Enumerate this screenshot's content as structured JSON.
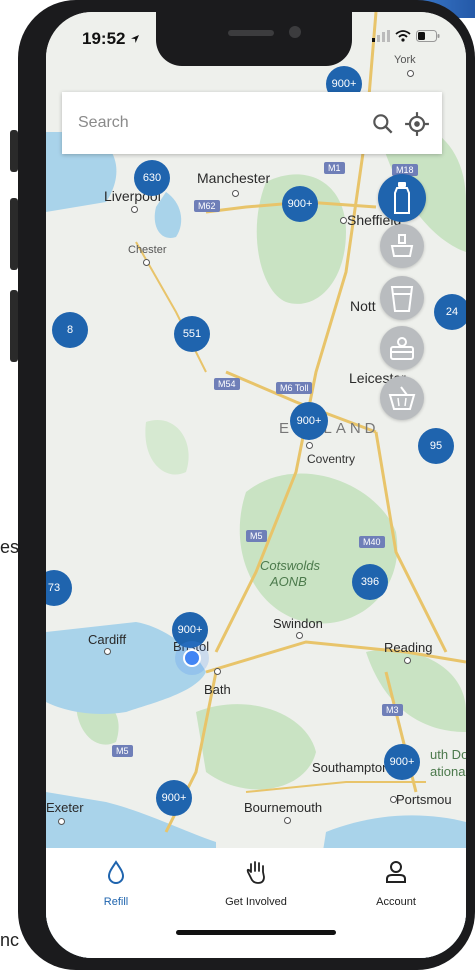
{
  "status_bar": {
    "time": "19:52"
  },
  "search": {
    "placeholder": "Search"
  },
  "map": {
    "places": [
      {
        "name": "York"
      },
      {
        "name": "Manchester"
      },
      {
        "name": "Liverpool"
      },
      {
        "name": "Sheffield"
      },
      {
        "name": "Chester"
      },
      {
        "name": "Nott"
      },
      {
        "name": "Leicester"
      },
      {
        "name": "ENGLAND"
      },
      {
        "name": "Coventry"
      },
      {
        "name": "Cotswolds"
      },
      {
        "name": "AONB"
      },
      {
        "name": "Swindon"
      },
      {
        "name": "Cardiff"
      },
      {
        "name": "Bristol"
      },
      {
        "name": "Reading"
      },
      {
        "name": "Bath"
      },
      {
        "name": "Southampton"
      },
      {
        "name": "uth Do"
      },
      {
        "name": "ational"
      },
      {
        "name": "Exeter"
      },
      {
        "name": "Bournemouth"
      },
      {
        "name": "Portsmou"
      }
    ],
    "roads": [
      "M1",
      "M62",
      "M18",
      "M54",
      "M6 Toll",
      "M5",
      "M40",
      "M3",
      "M5"
    ],
    "clusters": [
      "900+",
      "630",
      "900+",
      "24",
      "8",
      "551",
      "900+",
      "95",
      "396",
      "73",
      "900+",
      "900+",
      "900+"
    ]
  },
  "categories": [
    {
      "name": "bottle-icon",
      "active": true
    },
    {
      "name": "tap-icon",
      "active": false
    },
    {
      "name": "cup-icon",
      "active": false
    },
    {
      "name": "lunchbox-icon",
      "active": false
    },
    {
      "name": "basket-icon",
      "active": false
    }
  ],
  "tabs": [
    {
      "label": "Refill",
      "icon": "drop-icon",
      "active": true
    },
    {
      "label": "Get Involved",
      "icon": "hand-icon",
      "active": false
    },
    {
      "label": "Account",
      "icon": "person-icon",
      "active": false
    }
  ],
  "background_text": [
    "es",
    "nc"
  ],
  "colors": {
    "accent": "#1f64ae",
    "map_green": "#c9e3c3",
    "map_water": "#a9d3ea"
  }
}
